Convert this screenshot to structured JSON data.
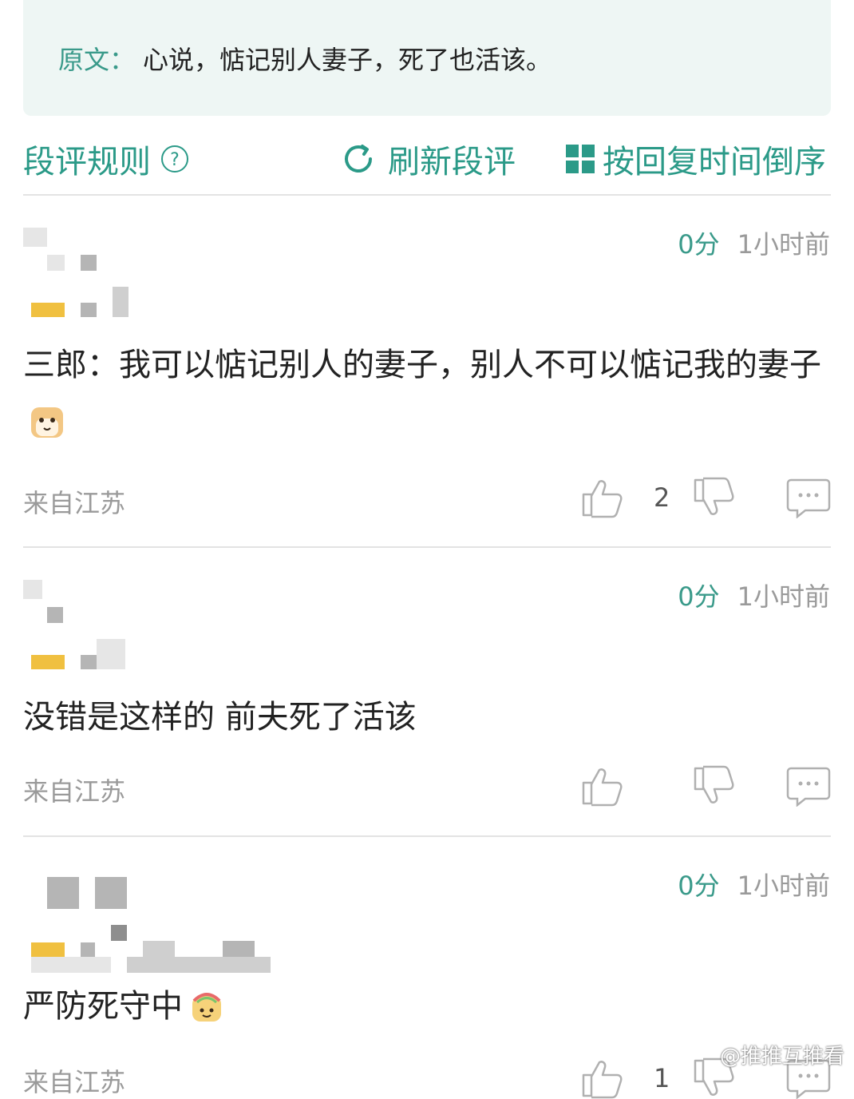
{
  "quote": {
    "label": "原文：",
    "text": "心说，惦记别人妻子，死了也活该。"
  },
  "toolbar": {
    "rules_label": "段评规则",
    "refresh_label": "刷新段评",
    "sort_label": "按回复时间倒序"
  },
  "comments": [
    {
      "score": "0分",
      "time": "1小时前",
      "text": "三郎：我可以惦记别人的妻子，别人不可以惦记我的妻子",
      "region": "来自江苏",
      "likes": "2",
      "emoji": "shiba-emoji"
    },
    {
      "score": "0分",
      "time": "1小时前",
      "text": "没错是这样的 前夫死了活该",
      "region": "来自江苏",
      "likes": ""
    },
    {
      "score": "0分",
      "time": "1小时前",
      "text": "严防死守中",
      "region": "来自江苏",
      "likes": "1",
      "emoji": "rainbow-emoji"
    }
  ],
  "watermark": "@推推互推看",
  "colors": {
    "accent": "#2b9a88",
    "muted": "#9a9a9a",
    "quote_bg": "#eef6f4"
  }
}
